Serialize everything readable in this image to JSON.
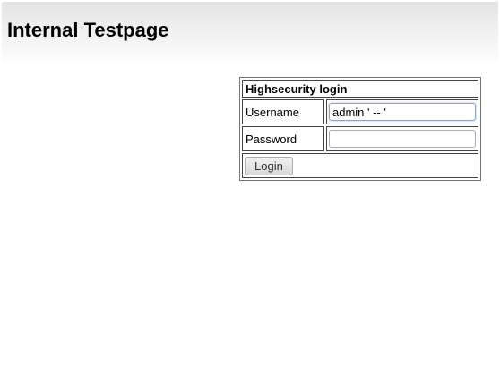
{
  "header": {
    "title": "Internal Testpage"
  },
  "login": {
    "title": "Highsecurity login",
    "username_label": "Username",
    "username_value": "admin ' -- '",
    "password_label": "Password",
    "password_value": "",
    "login_button": "Login"
  }
}
